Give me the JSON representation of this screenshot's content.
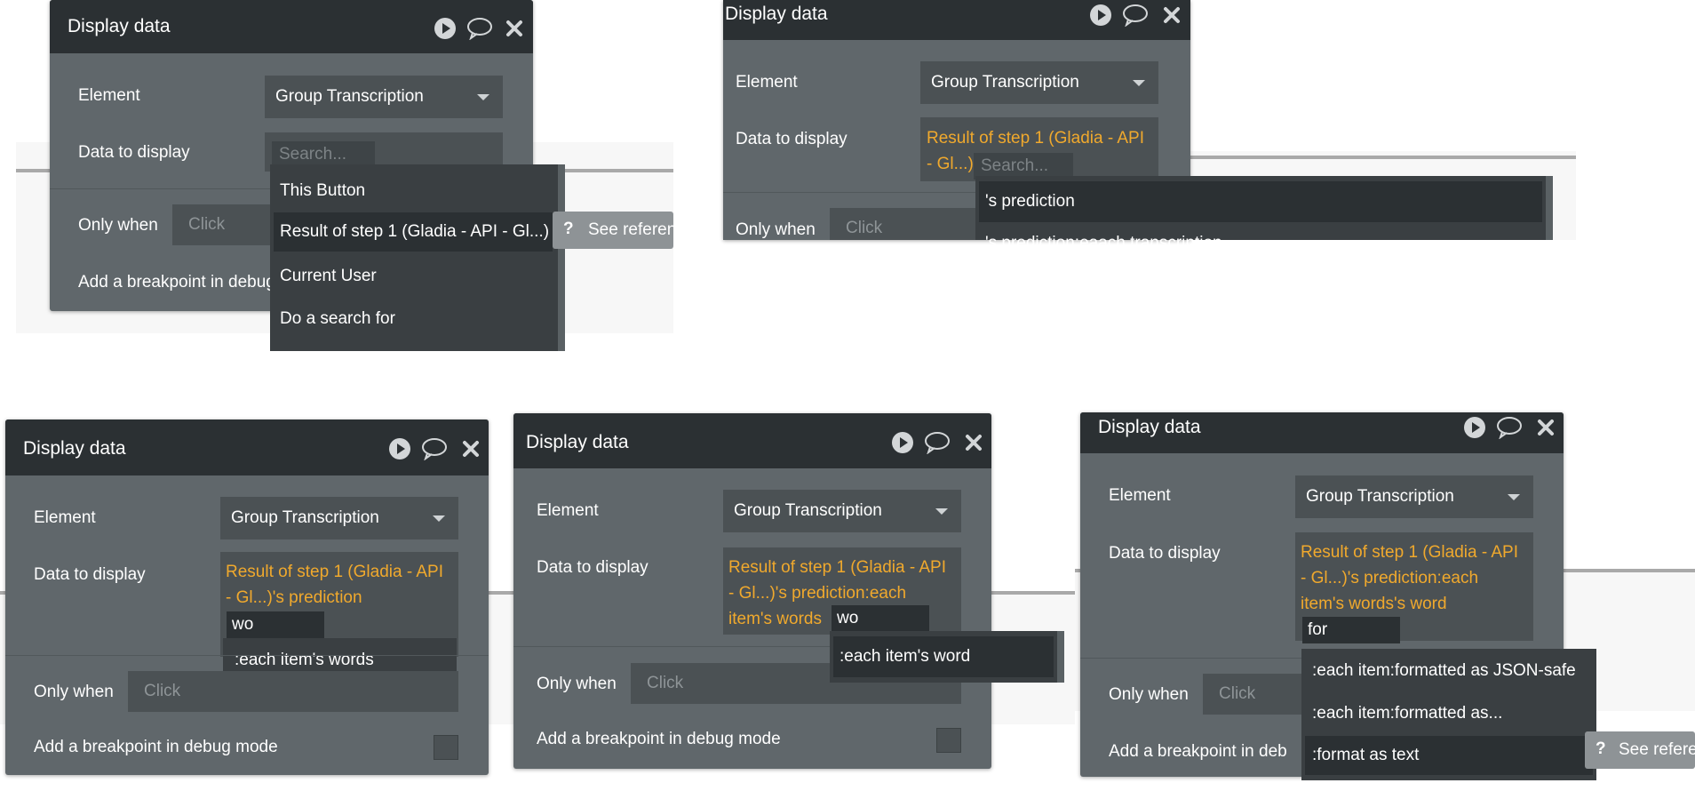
{
  "panel_title": "Display data",
  "labels": {
    "element": "Element",
    "data_to_display": "Data to display",
    "only_when": "Only when",
    "breakpoint": "Add a breakpoint in debug mode",
    "breakpoint_short": "Add a breakpoint in deb"
  },
  "element_value": "Group Transcription",
  "search_placeholder": "Search...",
  "only_when_placeholder": "Click",
  "see_reference": "See reference",
  "icons": {
    "play": "play-circle-icon",
    "comment": "speech-bubble-icon",
    "close": "close-x-icon",
    "help": "question-mark-icon",
    "caret": "chevron-down-icon"
  },
  "colors": {
    "header": "#2b3033",
    "panel": "#60676b",
    "field": "#4b5154",
    "expression": "#f0a92d",
    "dropdown": "#3a3f42",
    "highlight": "#2b3033"
  },
  "panel1": {
    "dropdown_items": [
      "This Button",
      "Result of step 1 (Gladia - API - Gl...)",
      "Current User",
      "Do a search for"
    ],
    "highlighted_index": 1
  },
  "panel2": {
    "expression_line1": "Result of step 1 (Gladia - API",
    "expression_line2": "- Gl...)",
    "dropdown_items": [
      "'s prediction",
      "'s prediction:eaach transcription"
    ]
  },
  "panel3": {
    "expression_line1": "Result of step 1 (Gladia - API",
    "expression_line2": "- Gl...)'s prediction",
    "typed": "wo",
    "dropdown_items": [
      ":each item's words"
    ]
  },
  "panel4": {
    "expression_line1": "Result of step 1 (Gladia - API",
    "expression_line2": "- Gl...)'s prediction:each",
    "expression_line3": "item's words",
    "typed": "wo",
    "dropdown_items": [
      ":each item's word"
    ]
  },
  "panel5": {
    "expression_line1": "Result of step 1 (Gladia - API",
    "expression_line2": "- Gl...)'s prediction:each",
    "expression_line3": "item's words's word",
    "typed": "for",
    "dropdown_items": [
      ":each item:formatted as JSON-safe",
      ":each item:formatted as...",
      ":format as text"
    ],
    "highlighted_index": 2
  }
}
